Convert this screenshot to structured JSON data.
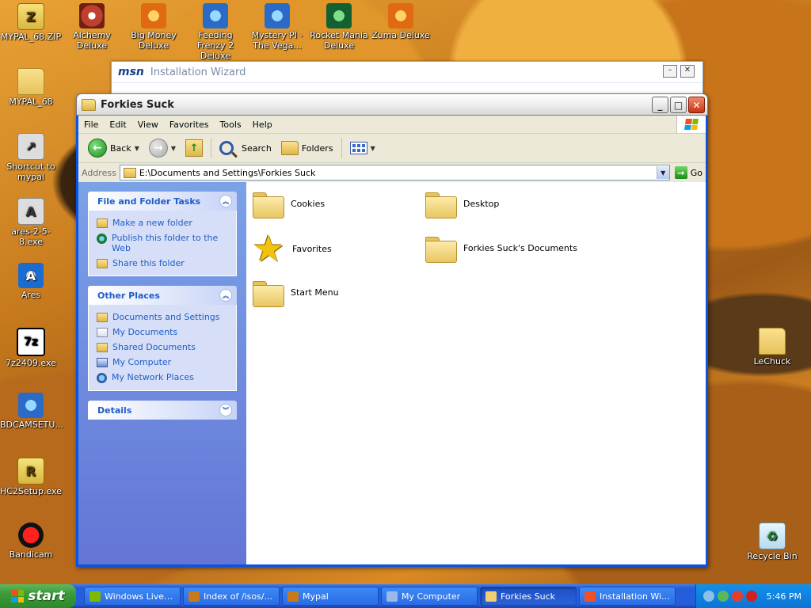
{
  "desktop": {
    "icons": [
      {
        "label": "MYPAL_68.ZIP"
      },
      {
        "label": "Alchemy Deluxe"
      },
      {
        "label": "Big Money Deluxe"
      },
      {
        "label": "Feeding Frenzy 2 Deluxe"
      },
      {
        "label": "Mystery PI - The Vega..."
      },
      {
        "label": "Rocket Mania Deluxe"
      },
      {
        "label": "Zuma Deluxe"
      },
      {
        "label": "MYPAL_68"
      },
      {
        "label": "Shortcut to mypal"
      },
      {
        "label": "ares-2-5-8.exe"
      },
      {
        "label": "Ares"
      },
      {
        "label": "7z2409.exe"
      },
      {
        "label": "BDCAMSETU..."
      },
      {
        "label": "HC2Setup.exe"
      },
      {
        "label": "Bandicam"
      },
      {
        "label": "LeChuck"
      },
      {
        "label": "Recycle Bin"
      }
    ]
  },
  "msn_window": {
    "logo": "msn",
    "title": "Installation Wizard"
  },
  "explorer": {
    "title": "Forkies Suck",
    "menu": [
      "File",
      "Edit",
      "View",
      "Favorites",
      "Tools",
      "Help"
    ],
    "toolbar": {
      "back_label": "Back",
      "search_label": "Search",
      "folders_label": "Folders"
    },
    "address": {
      "label": "Address",
      "value": "E:\\Documents and Settings\\Forkies Suck",
      "go_label": "Go"
    },
    "tasks_panel": {
      "title": "File and Folder Tasks",
      "items": [
        "Make a new folder",
        "Publish this folder to the Web",
        "Share this folder"
      ]
    },
    "other_places": {
      "title": "Other Places",
      "items": [
        "Documents and Settings",
        "My Documents",
        "Shared Documents",
        "My Computer",
        "My Network Places"
      ]
    },
    "details": {
      "title": "Details"
    },
    "items": [
      {
        "name": "Cookies"
      },
      {
        "name": "Desktop"
      },
      {
        "name": "Favorites"
      },
      {
        "name": "Forkies Suck's Documents"
      },
      {
        "name": "Start Menu"
      }
    ]
  },
  "taskbar": {
    "start_label": "start",
    "tasks": [
      {
        "label": "Windows Live ..."
      },
      {
        "label": "Index of /isos/..."
      },
      {
        "label": "Mypal"
      },
      {
        "label": "My Computer"
      },
      {
        "label": "Forkies Suck"
      },
      {
        "label": "Installation Wi..."
      }
    ],
    "clock": "5:46 PM"
  },
  "colors": {
    "xp_blue": "#0a54e3",
    "taskpane_link": "#215dc6",
    "start_green": "#3c9a3a"
  }
}
